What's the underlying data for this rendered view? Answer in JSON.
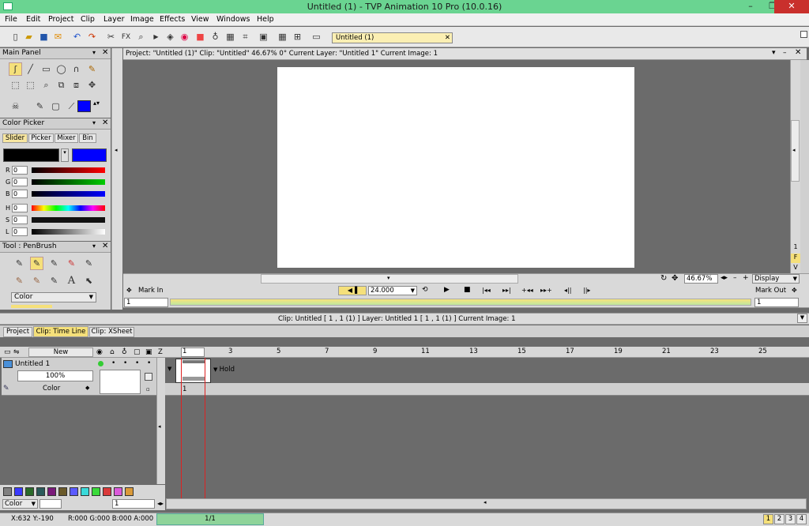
{
  "window": {
    "title": "Untitled (1) - TVP Animation 10 Pro (10.0.16)",
    "minimize": "–",
    "restore": "❐",
    "close": "✕"
  },
  "menu": [
    "File",
    "Edit",
    "Project",
    "Clip",
    "Layer",
    "Image",
    "Effects",
    "View",
    "Windows",
    "Help"
  ],
  "toolbar": {
    "fx_label": "FX",
    "project_tab": "Untitled (1)",
    "tab_close": "✕"
  },
  "main_panel": {
    "title": "Main Panel",
    "close": "✕"
  },
  "color_picker": {
    "title": "Color Picker",
    "close": "✕",
    "tabs": [
      "Slider",
      "Picker",
      "Mixer",
      "Bin"
    ],
    "primary_color": "#000000",
    "secondary_color": "#0000ff",
    "sliders": [
      {
        "label": "R",
        "value": "0"
      },
      {
        "label": "G",
        "value": "0"
      },
      {
        "label": "B",
        "value": "0"
      },
      {
        "label": "H",
        "value": "0"
      },
      {
        "label": "S",
        "value": "0"
      },
      {
        "label": "L",
        "value": "0"
      }
    ]
  },
  "tool_panel": {
    "title": "Tool : PenBrush",
    "close": "✕",
    "mode": "Color",
    "text_tool": "A"
  },
  "viewer": {
    "info": "Project: \"Untitled (1)\"  Clip: \"Untitled\"   46.67%   0°  Current Layer: \"Untitled 1\"  Current Image: 1",
    "zoom": "46.67%",
    "display": "Display",
    "fps": "24.000",
    "mark_in": "Mark In",
    "mark_out": "Mark Out",
    "mark_in_value": "1",
    "mark_out_value": "1",
    "side_labels": [
      "1",
      "F",
      "V"
    ]
  },
  "timeline": {
    "info": "Clip: Untitled [ 1 , 1  (1) ]        Layer: Untitled 1 [ 1 , 1  (1) ]   Current Image: 1",
    "tabs": [
      "Project",
      "Clip: Time Line",
      "Clip: XSheet"
    ],
    "new_button": "New",
    "z_label": "Z",
    "ruler": [
      "1",
      "3",
      "5",
      "7",
      "9",
      "11",
      "13",
      "15",
      "17",
      "19",
      "21",
      "23",
      "25"
    ],
    "layer": {
      "name": "Untitled 1",
      "opacity": "100%",
      "mode": "Color",
      "hold": "Hold",
      "frame": "1"
    },
    "bottom_mode": "Color",
    "bottom_value": "1",
    "swatch_colors": [
      "#808080",
      "#3a3aff",
      "#2a6a2a",
      "#2a5a5a",
      "#7a1a7a",
      "#6a5a2a",
      "#5a5aff",
      "#3adada",
      "#3ada3a",
      "#da3a3a",
      "#da5ada",
      "#da9a3a"
    ]
  },
  "status": {
    "coords": "X:632  Y:-190",
    "rgba": "R:000 G:000 B:000 A:000",
    "page": "1/1",
    "pages": [
      "1",
      "2",
      "3",
      "4"
    ]
  }
}
